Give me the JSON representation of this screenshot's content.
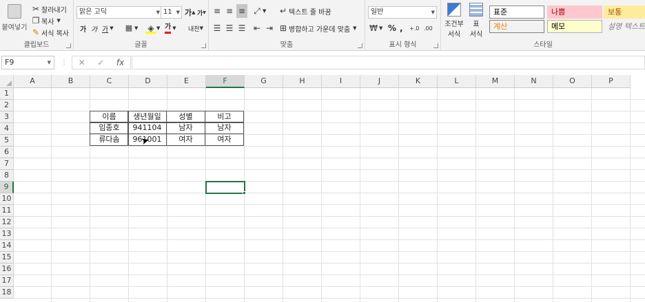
{
  "ribbon": {
    "clipboard": {
      "paste_label": "붙여넣기",
      "cut_label": "잘라내기",
      "copy_label": "복사",
      "format_painter_label": "서식 복사",
      "group_label": "클립보드"
    },
    "font": {
      "font_name": "맑은 고딕",
      "font_size": "11",
      "grow_label": "가",
      "shrink_label": "가",
      "bold_label": "가",
      "italic_label": "가",
      "underline_label": "가",
      "font_color_label": "가",
      "phonetic_label": "내천",
      "group_label": "글꼴"
    },
    "alignment": {
      "wrap_text_label": "텍스트 줄 바꿈",
      "merge_center_label": "병합하고 가운데 맞춤",
      "group_label": "맞춤"
    },
    "number": {
      "format_value": "일반",
      "percent_label": "%",
      "comma_label": ",",
      "inc_decimal_label": "+.0",
      "dec_decimal_label": ".00",
      "group_label": "표시 형식"
    },
    "styles": {
      "conditional_label_1": "조건부",
      "conditional_label_2": "서식",
      "table_label_1": "표",
      "table_label_2": "서식",
      "boxes": [
        {
          "label": "표준",
          "bg": "#ffffff",
          "color": "#000000",
          "border": "#8a8a8a"
        },
        {
          "label": "나쁨",
          "bg": "#ffc7ce",
          "color": "#9c0006",
          "border": "#ffc7ce"
        },
        {
          "label": "보통",
          "bg": "#ffeb9c",
          "color": "#9c5700",
          "border": "#ffeb9c"
        },
        {
          "label": "계산",
          "bg": "#f2f2f2",
          "color": "#fa7d00",
          "border": "#7f7f7f"
        },
        {
          "label": "메모",
          "bg": "#ffffcc",
          "color": "#000000",
          "border": "#b2b2b2"
        },
        {
          "label": "설명 텍스트",
          "bg": "#f3f3f3",
          "color": "#7f7f7f",
          "border": "#f3f3f3"
        }
      ],
      "group_label": "스타일"
    }
  },
  "formula_bar": {
    "name_box": "F9",
    "cancel_icon": "✕",
    "enter_icon": "✓",
    "fx_label": "fx",
    "formula": ""
  },
  "sheet": {
    "columns": [
      "A",
      "B",
      "C",
      "D",
      "E",
      "F",
      "G",
      "H",
      "I",
      "J",
      "K",
      "L",
      "M",
      "N",
      "O",
      "P"
    ],
    "rows": [
      "1",
      "2",
      "3",
      "4",
      "5",
      "6",
      "7",
      "8",
      "9",
      "10",
      "11",
      "12",
      "13",
      "14",
      "15",
      "16",
      "17",
      "18"
    ],
    "selected_cell": "F9",
    "table": {
      "headers": [
        "이름",
        "생년월일",
        "성별",
        "비고"
      ],
      "rows": [
        [
          "임종호",
          "941104",
          "남자",
          "남자"
        ],
        [
          "류다솜",
          "961001",
          "여자",
          "여자"
        ]
      ]
    }
  },
  "colors": {
    "accent": "#217346"
  }
}
